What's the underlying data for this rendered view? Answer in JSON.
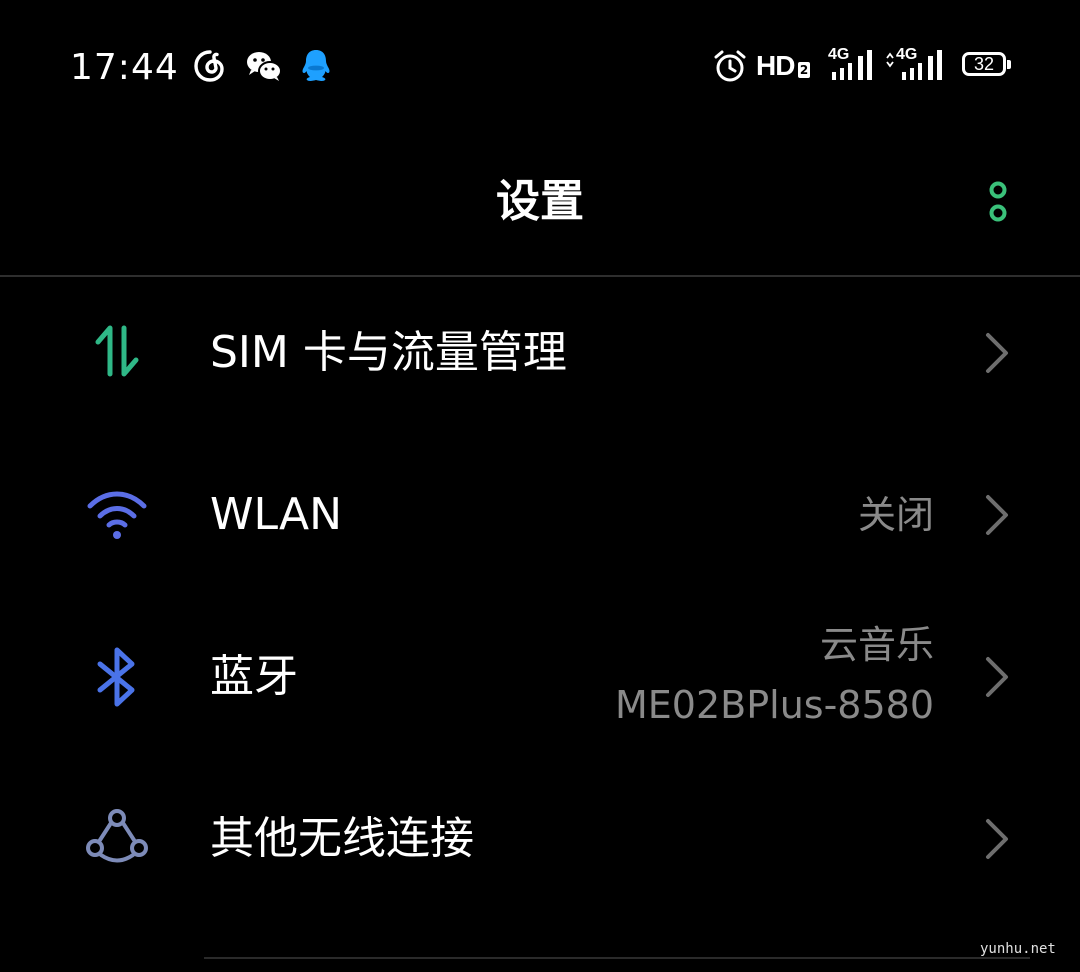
{
  "status_bar": {
    "time": "17:44",
    "notification_icons": [
      "netease-music-icon",
      "wechat-icon",
      "qq-icon"
    ],
    "hd_label": "HD",
    "hd_sub": "2",
    "network_1": "4G",
    "network_2": "4G",
    "battery_level": "32",
    "colors": {
      "qq": "#1ea0ff"
    }
  },
  "header": {
    "title": "设置",
    "more_icon": "more-vertical-icon",
    "accent_color": "#3ac17a"
  },
  "settings": {
    "items": [
      {
        "label": "SIM 卡与流量管理",
        "value": "",
        "icon": "sim-data-icon",
        "icon_color": "#2fb887"
      },
      {
        "label": "WLAN",
        "value": "关闭",
        "icon": "wifi-icon",
        "icon_color": "#5b6ee6"
      },
      {
        "label": "蓝牙",
        "value_line1": "云音乐",
        "value_line2": "ME02BPlus-8580",
        "icon": "bluetooth-icon",
        "icon_color": "#4a73e8"
      },
      {
        "label": "其他无线连接",
        "value": "",
        "icon": "other-wireless-icon",
        "icon_color": "#7d8bb8"
      }
    ]
  },
  "watermark": "yunhu.net"
}
